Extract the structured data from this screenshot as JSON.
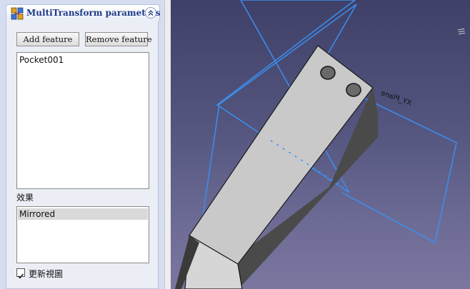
{
  "panel": {
    "title": "MultiTransform parameters",
    "add_feature_label": "Add feature",
    "remove_feature_label": "Remove feature",
    "features": [
      "Pocket001"
    ],
    "effects_label": "效果",
    "effects": [
      "Mirrored"
    ],
    "update_view_label": "更新視圖",
    "update_view_checked": true
  },
  "viewport": {
    "plane_label": "XY_Plane",
    "colors": {
      "plane_outline": "#3b8ff0",
      "solid_top": "#c9c9c9",
      "solid_side": "#4a4a4a"
    }
  }
}
